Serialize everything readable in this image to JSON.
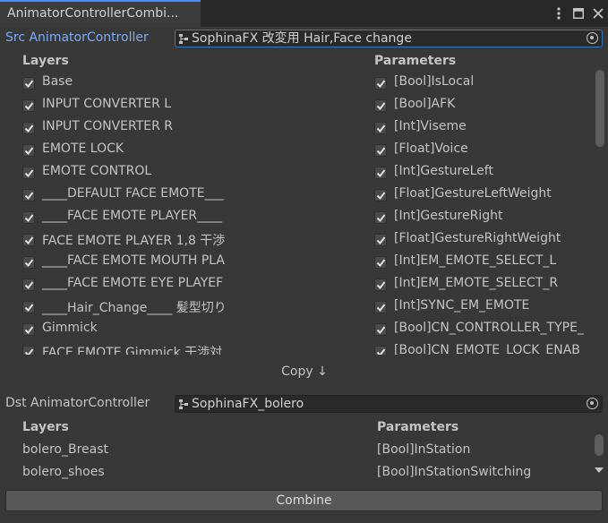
{
  "window": {
    "tab_title": "AnimatorControllerCombi..."
  },
  "src": {
    "label": "Src AnimatorController",
    "value": "SophinaFX 改変用  Hair,Face change",
    "layers_header": "Layers",
    "params_header": "Parameters",
    "layers": [
      {
        "label": "Base",
        "checked": true
      },
      {
        "label": "INPUT CONVERTER L",
        "checked": true
      },
      {
        "label": "INPUT CONVERTER R",
        "checked": true
      },
      {
        "label": "EMOTE LOCK",
        "checked": true
      },
      {
        "label": "EMOTE CONTROL",
        "checked": true
      },
      {
        "label": "____DEFAULT FACE EMOTE___",
        "checked": true
      },
      {
        "label": "____FACE EMOTE PLAYER____",
        "checked": true
      },
      {
        "label": "FACE EMOTE PLAYER 1,8 干渉",
        "checked": true
      },
      {
        "label": "____FACE EMOTE MOUTH PLA",
        "checked": true
      },
      {
        "label": "____FACE EMOTE EYE PLAYEF",
        "checked": true
      },
      {
        "label": "____Hair_Change____ 髪型切り",
        "checked": true
      },
      {
        "label": "Gimmick",
        "checked": true
      },
      {
        "label": "FACE EMOTE Gimmick 干渉対",
        "checked": true
      }
    ],
    "params": [
      {
        "label": "[Bool]IsLocal",
        "checked": true
      },
      {
        "label": "[Bool]AFK",
        "checked": true
      },
      {
        "label": "[Int]Viseme",
        "checked": true
      },
      {
        "label": "[Float]Voice",
        "checked": true
      },
      {
        "label": "[Int]GestureLeft",
        "checked": true
      },
      {
        "label": "[Float]GestureLeftWeight",
        "checked": true
      },
      {
        "label": "[Int]GestureRight",
        "checked": true
      },
      {
        "label": "[Float]GestureRightWeight",
        "checked": true
      },
      {
        "label": "[Int]EM_EMOTE_SELECT_L",
        "checked": true
      },
      {
        "label": "[Int]EM_EMOTE_SELECT_R",
        "checked": true
      },
      {
        "label": "[Int]SYNC_EM_EMOTE",
        "checked": true
      },
      {
        "label": "[Bool]CN_CONTROLLER_TYPE_",
        "checked": true
      },
      {
        "label": "[Bool]CN_EMOTE_LOCK_ENAB",
        "checked": true
      }
    ],
    "scroll_fraction": 0.0
  },
  "copy_label": "Copy ↓",
  "dst": {
    "label": "Dst AnimatorController",
    "value": "SophinaFX_bolero",
    "layers_header": "Layers",
    "params_header": "Parameters",
    "layers": [
      "bolero_Breast",
      "bolero_shoes"
    ],
    "params": [
      "[Bool]InStation",
      "[Bool]InStationSwitching"
    ]
  },
  "combine_label": "Combine",
  "icons": [
    "kebab-menu-icon",
    "maximize-icon",
    "close-icon",
    "object-picker-icon",
    "animator-controller-icon",
    "checkmark-icon"
  ],
  "colors": {
    "accent": "#4a8cf7",
    "active_label": "#7cacf8",
    "background": "#383838"
  }
}
